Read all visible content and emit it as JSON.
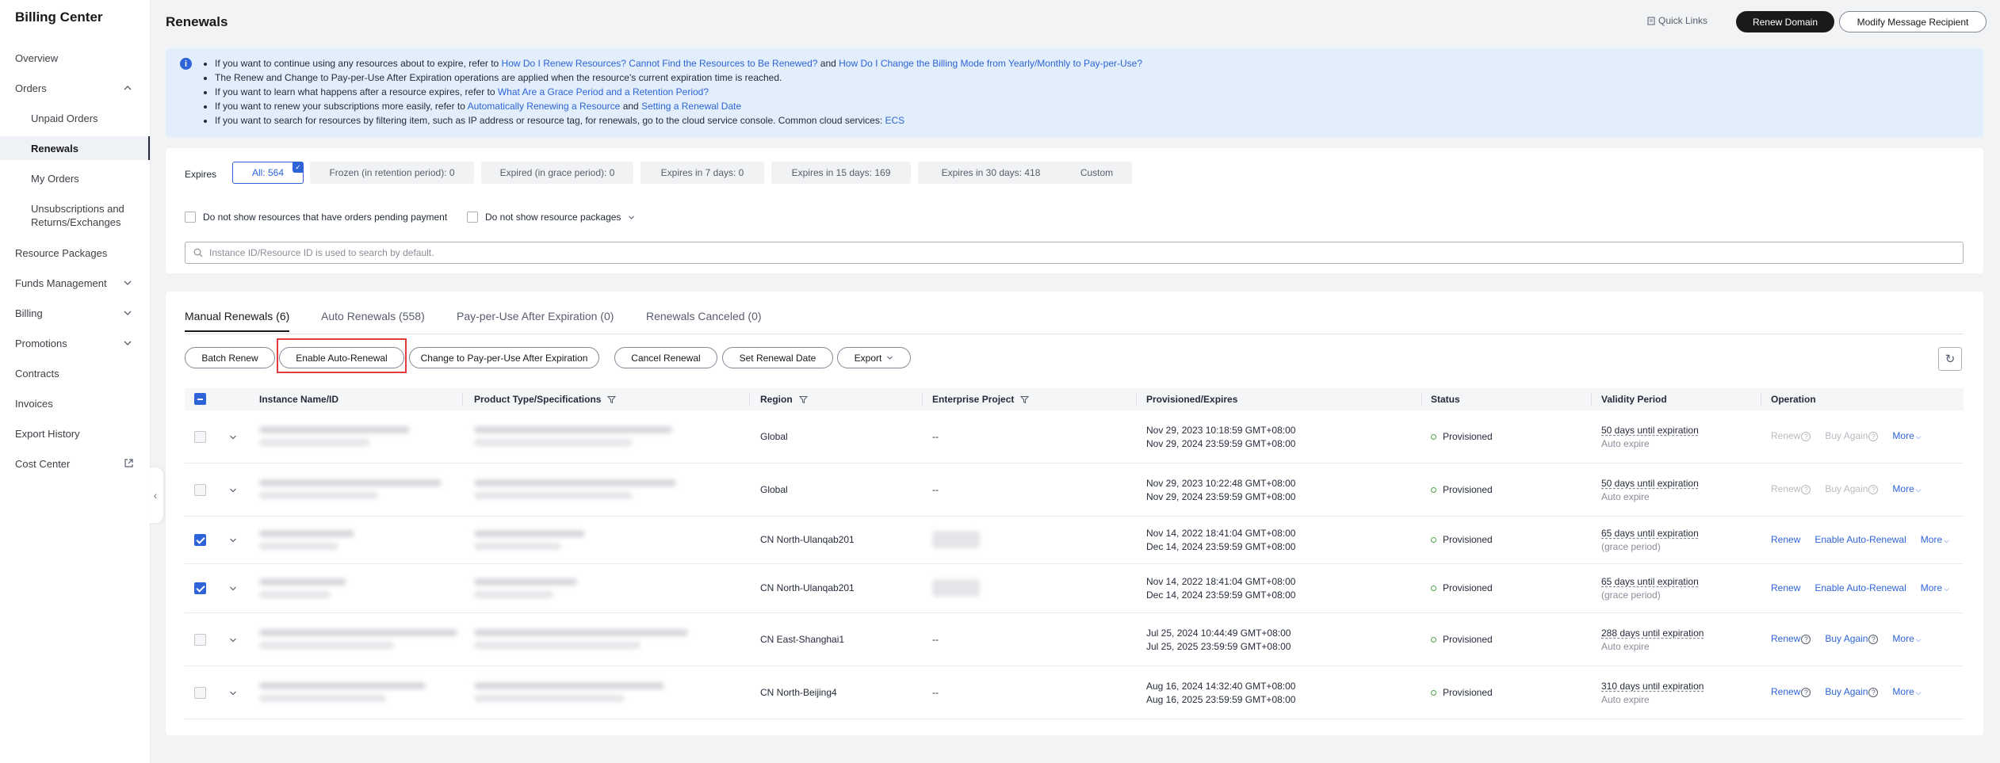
{
  "sidebar": {
    "title": "Billing Center",
    "items": [
      {
        "label": "Overview"
      },
      {
        "label": "Orders"
      },
      {
        "label": "Unpaid Orders"
      },
      {
        "label": "Renewals"
      },
      {
        "label": "My Orders"
      },
      {
        "label": "Unsubscriptions and Returns/Exchanges"
      },
      {
        "label": "Resource Packages"
      },
      {
        "label": "Funds Management"
      },
      {
        "label": "Billing"
      },
      {
        "label": "Promotions"
      },
      {
        "label": "Contracts"
      },
      {
        "label": "Invoices"
      },
      {
        "label": "Export History"
      },
      {
        "label": "Cost Center"
      }
    ]
  },
  "header": {
    "title": "Renewals",
    "quick_links": "Quick Links",
    "renew_domain": "Renew Domain",
    "modify_recipient": "Modify Message Recipient"
  },
  "notice": {
    "l1_a": "If you want to continue using any resources about to expire, refer to ",
    "l1_link1": "How Do I Renew Resources? Cannot Find the Resources to Be Renewed?",
    "l1_b": " and ",
    "l1_link2": "How Do I Change the Billing Mode from Yearly/Monthly to Pay-per-Use?",
    "l2": "The Renew and Change to Pay-per-Use After Expiration operations are applied when the resource's current expiration time is reached.",
    "l3_a": "If you want to learn what happens after a resource expires, refer to ",
    "l3_link": "What Are a Grace Period and a Retention Period?",
    "l4_a": "If you want to renew your subscriptions more easily, refer to ",
    "l4_link1": "Automatically Renewing a Resource",
    "l4_b": " and ",
    "l4_link2": "Setting a Renewal Date",
    "l5_a": "If you want to search for resources by filtering item, such as IP address or resource tag, for renewals, go to the cloud service console. Common cloud services: ",
    "l5_link": "ECS"
  },
  "filters": {
    "expires_label": "Expires",
    "chips": [
      {
        "label": "All: 564"
      },
      {
        "label": "Frozen (in retention period): 0"
      },
      {
        "label": "Expired (in grace period): 0"
      },
      {
        "label": "Expires in 7 days: 0"
      },
      {
        "label": "Expires in 15 days: 169"
      },
      {
        "label": "Expires in 30 days: 418"
      },
      {
        "label": "Custom"
      }
    ],
    "pending_payment": "Do not show resources that have orders pending payment",
    "resource_packages": "Do not show resource packages",
    "search_placeholder": "Instance ID/Resource ID is used to search by default."
  },
  "tabs": [
    {
      "label": "Manual Renewals (6)"
    },
    {
      "label": "Auto Renewals (558)"
    },
    {
      "label": "Pay-per-Use After Expiration (0)"
    },
    {
      "label": "Renewals Canceled (0)"
    }
  ],
  "toolbar": {
    "batch_renew": "Batch Renew",
    "enable_auto": "Enable Auto-Renewal",
    "change_ppu": "Change to Pay-per-Use After Expiration",
    "cancel_renewal": "Cancel Renewal",
    "set_date": "Set Renewal Date",
    "export": "Export"
  },
  "table": {
    "headers": {
      "instance": "Instance Name/ID",
      "product": "Product Type/Specifications",
      "region": "Region",
      "enterprise": "Enterprise Project",
      "provisioned": "Provisioned/Expires",
      "status": "Status",
      "validity": "Validity Period",
      "operation": "Operation"
    },
    "rows": [
      {
        "region": "Global",
        "enterprise": "--",
        "prov": "Nov 29, 2023 10:18:59 GMT+08:00",
        "exp": "Nov 29, 2024 23:59:59 GMT+08:00",
        "status": "Provisioned",
        "validity": "50 days until expiration",
        "validity_sub": "Auto expire",
        "op1": "Renew",
        "op2": "Buy Again",
        "more": "More"
      },
      {
        "region": "Global",
        "enterprise": "--",
        "prov": "Nov 29, 2023 10:22:48 GMT+08:00",
        "exp": "Nov 29, 2024 23:59:59 GMT+08:00",
        "status": "Provisioned",
        "validity": "50 days until expiration",
        "validity_sub": "Auto expire",
        "op1": "Renew",
        "op2": "Buy Again",
        "more": "More"
      },
      {
        "region": "CN North-Ulanqab201",
        "enterprise": "",
        "prov": "Nov 14, 2022 18:41:04 GMT+08:00",
        "exp": "Dec 14, 2024 23:59:59 GMT+08:00",
        "status": "Provisioned",
        "validity": "65 days until expiration",
        "validity_sub": "(grace period)",
        "op1": "Renew",
        "op2": "Enable Auto-Renewal",
        "more": "More"
      },
      {
        "region": "CN North-Ulanqab201",
        "enterprise": "",
        "prov": "Nov 14, 2022 18:41:04 GMT+08:00",
        "exp": "Dec 14, 2024 23:59:59 GMT+08:00",
        "status": "Provisioned",
        "validity": "65 days until expiration",
        "validity_sub": "(grace period)",
        "op1": "Renew",
        "op2": "Enable Auto-Renewal",
        "more": "More"
      },
      {
        "region": "CN East-Shanghai1",
        "enterprise": "--",
        "prov": "Jul 25, 2024 10:44:49 GMT+08:00",
        "exp": "Jul 25, 2025 23:59:59 GMT+08:00",
        "status": "Provisioned",
        "validity": "288 days until expiration",
        "validity_sub": "Auto expire",
        "op1": "Renew",
        "op2": "Buy Again",
        "more": "More"
      },
      {
        "region": "CN North-Beijing4",
        "enterprise": "--",
        "prov": "Aug 16, 2024 14:32:40 GMT+08:00",
        "exp": "Aug 16, 2025 23:59:59 GMT+08:00",
        "status": "Provisioned",
        "validity": "310 days until expiration",
        "validity_sub": "Auto expire",
        "op1": "Renew",
        "op2": "Buy Again",
        "more": "More"
      }
    ]
  }
}
